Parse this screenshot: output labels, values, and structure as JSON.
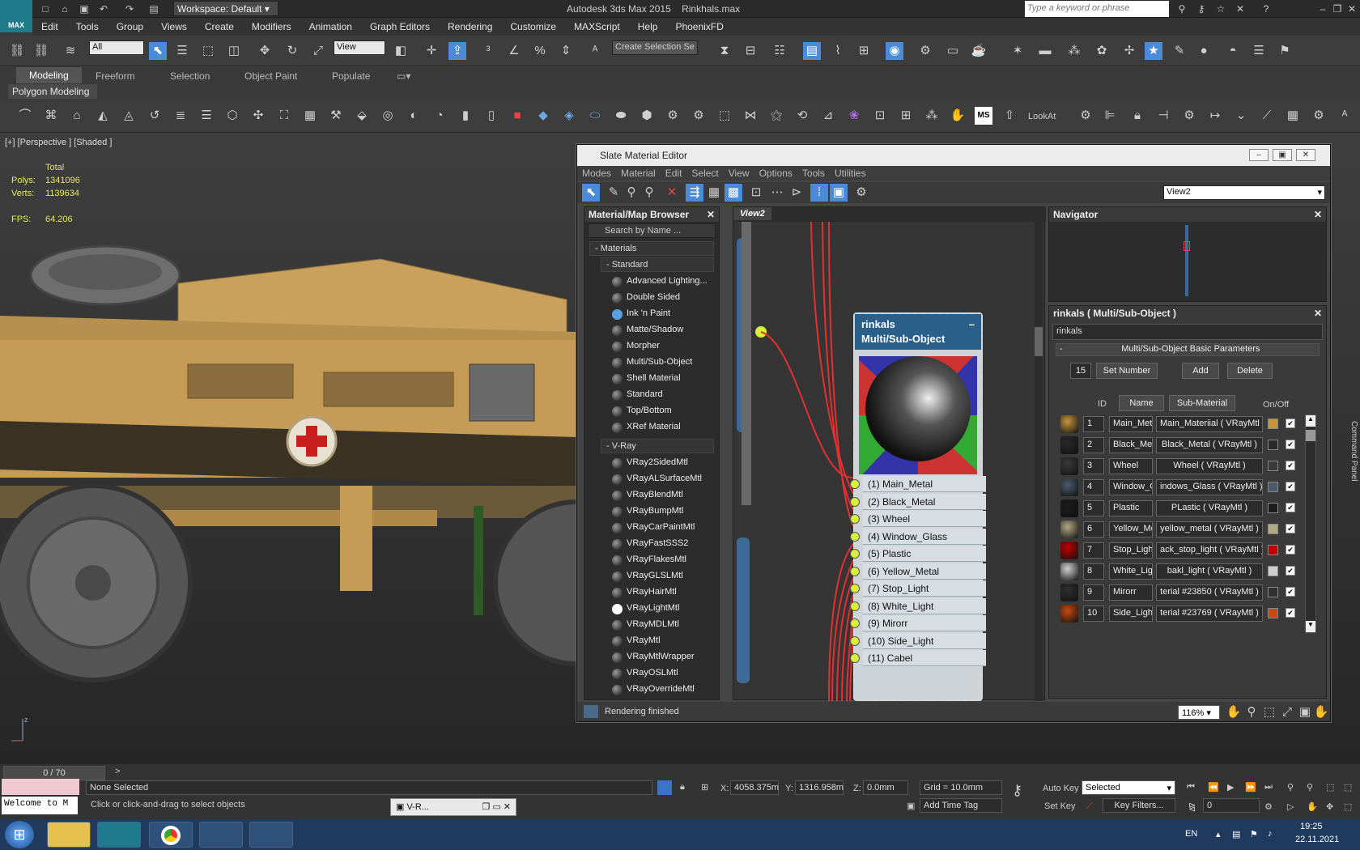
{
  "app": {
    "title": "Autodesk 3ds Max  2015",
    "file": "Rinkhals.max",
    "logo": "MAX",
    "workspace": "Workspace: Default",
    "search_placeholder": "Type a keyword or phrase"
  },
  "menu": [
    "Edit",
    "Tools",
    "Group",
    "Views",
    "Create",
    "Modifiers",
    "Animation",
    "Graph Editors",
    "Rendering",
    "Customize",
    "MAXScript",
    "Help",
    "PhoenixFD"
  ],
  "toolbar": {
    "filter": "All",
    "refcoord": "View",
    "selset": "Create Selection Se"
  },
  "ribbon": {
    "tabs": [
      "Modeling",
      "Freeform",
      "Selection",
      "Object Paint",
      "Populate"
    ],
    "panel": "Polygon Modeling"
  },
  "viewport": {
    "label": "[+] [Perspective ] [Shaded ]",
    "total_label": "Total",
    "polys_label": "Polys:",
    "polys": "1341096",
    "verts_label": "Verts:",
    "verts": "1139634",
    "fps_label": "FPS:",
    "fps": "64.206",
    "lookat": "LookAt"
  },
  "sme": {
    "title": "Slate Material Editor",
    "menu": [
      "Modes",
      "Material",
      "Edit",
      "Select",
      "View",
      "Options",
      "Tools",
      "Utilities"
    ],
    "view_select": "View2",
    "browser": {
      "title": "Material/Map Browser",
      "search": "Search by Name ...",
      "materials": "Materials",
      "standard": "Standard",
      "standard_items": [
        "Advanced Lighting...",
        "Double Sided",
        "Ink 'n Paint",
        "Matte/Shadow",
        "Morpher",
        "Multi/Sub-Object",
        "Shell Material",
        "Standard",
        "Top/Bottom",
        "XRef Material"
      ],
      "vray": "V-Ray",
      "vray_items": [
        "VRay2SidedMtl",
        "VRayALSurfaceMtl",
        "VRayBlendMtl",
        "VRayBumpMtl",
        "VRayCarPaintMtl",
        "VRayFastSSS2",
        "VRayFlakesMtl",
        "VRayGLSLMtl",
        "VRayHairMtl",
        "VRayLightMtl",
        "VRayMDLMtl",
        "VRayMtl",
        "VRayMtlWrapper",
        "VRayOSLMtl",
        "VRayOverrideMtl"
      ]
    },
    "view_tab": "View2",
    "node": {
      "name": "rinkals",
      "type": "Multi/Sub-Object",
      "slots": [
        "(1) Main_Metal",
        "(2) Black_Metal",
        "(3) Wheel",
        "(4) Window_Glass",
        "(5) Plastic",
        "(6) Yellow_Metal",
        "(7) Stop_Light",
        "(8) White_Light",
        "(9) Mirorr",
        "(10) Side_Light",
        "(11) Cabel"
      ]
    },
    "navigator": "Navigator",
    "params": {
      "title": "rinkals  ( Multi/Sub-Object )",
      "name": "rinkals",
      "rollout": "Multi/Sub-Object Basic Parameters",
      "count": "15",
      "set_number": "Set Number",
      "add": "Add",
      "delete": "Delete",
      "headers": {
        "id": "ID",
        "name": "Name",
        "sub": "Sub-Material",
        "onoff": "On/Off"
      },
      "rows": [
        {
          "id": "1",
          "name": "Main_Meta",
          "sub": "Main_Materiial  ( VRayMtl )",
          "color": "#c8963c"
        },
        {
          "id": "2",
          "name": "Black_Meta",
          "sub": "Black_Metal  ( VRayMtl )",
          "color": "#2a2a2a"
        },
        {
          "id": "3",
          "name": "Wheel",
          "sub": "Wheel  ( VRayMtl )",
          "color": "#3a3a3a"
        },
        {
          "id": "4",
          "name": "Window_G",
          "sub": "indows_Glass  ( VRayMtl )",
          "color": "#4c5a6e"
        },
        {
          "id": "5",
          "name": "Plastic",
          "sub": "PLastic  ( VRayMtl )",
          "color": "#1c1c1c"
        },
        {
          "id": "6",
          "name": "Yellow_Me",
          "sub": "yellow_metal  ( VRayMtl )",
          "color": "#b0a880"
        },
        {
          "id": "7",
          "name": "Stop_Light",
          "sub": "ack_stop_light  ( VRayMtl )",
          "color": "#c00000"
        },
        {
          "id": "8",
          "name": "White_Ligh",
          "sub": "bakl_light  ( VRayMtl )",
          "color": "#cfcfcf"
        },
        {
          "id": "9",
          "name": "Mirorr",
          "sub": "terial #23850  ( VRayMtl )",
          "color": "#303030"
        },
        {
          "id": "10",
          "name": "Side_Light",
          "sub": "terial #23769  ( VRayMtl )",
          "color": "#c84a10"
        }
      ]
    },
    "status": "Rendering finished",
    "zoom": "116%"
  },
  "status": {
    "timeline": "0 / 70",
    "listener": "Welcome to M",
    "selection": "None Selected",
    "prompt": "Click or click-and-drag to select objects",
    "x_label": "X:",
    "x": "4058.375m",
    "y_label": "Y:",
    "y": "1316.958m",
    "z_label": "Z:",
    "z": "0.0mm",
    "grid": "Grid = 10.0mm",
    "autokey": "Auto Key",
    "setkey": "Set Key",
    "keymode": "Selected",
    "keyfilters": "Key Filters...",
    "frame": "0",
    "addtime": "Add Time Tag",
    "minimized": "V-R..."
  },
  "taskbar": {
    "lang": "EN",
    "time": "19:25",
    "date": "22.11.2021"
  },
  "command_panel": "Command Panel"
}
